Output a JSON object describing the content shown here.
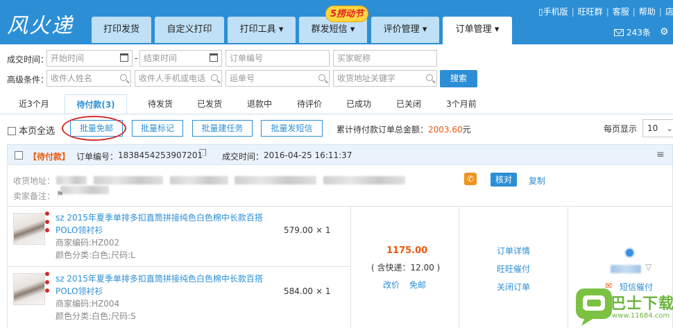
{
  "header": {
    "logo": "风火递",
    "promo_badge": "5捞动节",
    "nav": [
      "打印发货",
      "自定义打印",
      "打印工具",
      "群发短信",
      "评价管理",
      "订单管理"
    ],
    "top_links": [
      "手机版",
      "旺旺群",
      "客服",
      "帮助",
      "店"
    ],
    "message_count": "243条"
  },
  "filters": {
    "deal_time_label": "成交时间：",
    "start_placeholder": "开始时间",
    "dash": "-",
    "end_placeholder": "结束时间",
    "order_no_placeholder": "订单编号",
    "buyer_nick_placeholder": "买家昵称",
    "advanced_label": "高级条件：",
    "recipient_name_placeholder": "收件人姓名",
    "recipient_phone_placeholder": "收件人手机或电话",
    "waybill_placeholder": "运单号",
    "address_keyword_placeholder": "收货地址关键字",
    "search_button": "搜索"
  },
  "status_tabs": [
    "近3个月",
    "待付款(3)",
    "待发货",
    "已发货",
    "退款中",
    "待评价",
    "已成功",
    "已关闭",
    "3个月前"
  ],
  "active_status_tab": "待付款(3)",
  "actions": {
    "select_all": "本页全选",
    "buttons": [
      "批量免邮",
      "批量标记",
      "批量建任务",
      "批量发短信"
    ],
    "total_label": "累计待付款订单总金额：",
    "total_amount": "2003.60",
    "total_unit": "元",
    "per_page_label": "每页显示",
    "per_page_value": "10"
  },
  "order": {
    "status": "【待付款】",
    "order_no_label": "订单编号：",
    "order_no": "1838454253907201",
    "deal_time_label": "成交时间：",
    "deal_time": "2016-04-25 16:11:37",
    "address_label": "收货地址：",
    "verify_button": "核对",
    "copy_link": "复制",
    "seller_note_label": "卖家备注：",
    "items": [
      {
        "title": "sz 2015年夏季单排多扣直筒拼接纯色白色棉中长款百搭POLO领衬衫",
        "merchant_code": "商家编码:HZ002",
        "sku": "颜色分类:白色;尺码:L",
        "price": "579.00",
        "qty": "× 1"
      },
      {
        "title": "sz 2015年夏季单排多扣直筒拼接纯色白色棉中长款百搭POLO领衬衫",
        "merchant_code": "商家编码:HZ004",
        "sku": "颜色分类:白色;尺码:S",
        "price": "584.00",
        "qty": "× 1"
      }
    ],
    "total": "1175.00",
    "shipping": "( 含快递：12.00 )",
    "modify_price": "改价",
    "free_shipping": "免邮",
    "ops": [
      "订单详情",
      "旺旺催付",
      "关闭订单"
    ],
    "sms_remind": "短信催付"
  },
  "watermark": {
    "brand": "巴士下载",
    "url": "www.11684.com"
  },
  "colors": {
    "primary": "#2c8fd6",
    "amount": "#e8590c",
    "highlight_circle": "#d42b2b"
  }
}
